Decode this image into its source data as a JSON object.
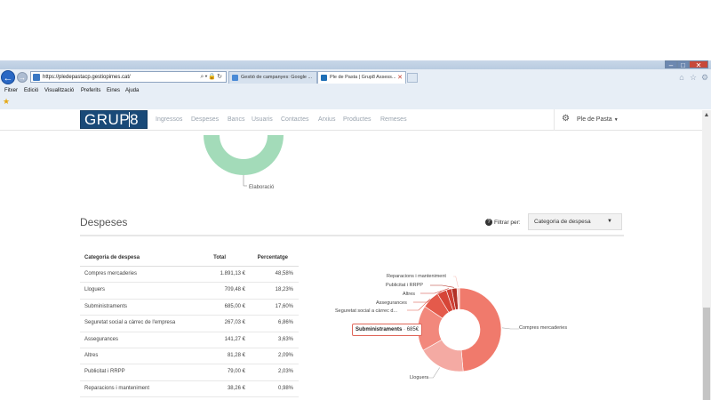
{
  "browser": {
    "address": "https://pledepastacp.gestiopimes.cat/",
    "tabs": [
      {
        "label": "Gestió de campanyes: Google ..."
      },
      {
        "label": "Ple de Pasta | Grup8 Assess..."
      }
    ],
    "menu": [
      "Fitxer",
      "Edició",
      "Visualització",
      "Preferits",
      "Eines",
      "Ajuda"
    ]
  },
  "site": {
    "logo": "GRUP8",
    "nav": [
      "Ingressos",
      "Despeses",
      "Bancs",
      "Usuaris",
      "Contactes",
      "Arxius",
      "Productes",
      "Remeses"
    ],
    "user": "Ple de Pasta"
  },
  "top_chart": {
    "label": "Elaboració",
    "color": "#a3dbb9"
  },
  "section": {
    "title": "Despeses",
    "filter_label": "Filtrar per:",
    "filter_value": "Categoria de despesa"
  },
  "table": {
    "headers": [
      "Categoria de despesa",
      "Total",
      "Percentatge"
    ],
    "rows": [
      [
        "Compres mercaderies",
        "1.891,13 €",
        "48,58%"
      ],
      [
        "Lloguers",
        "709,48 €",
        "18,23%"
      ],
      [
        "Subministraments",
        "685,00 €",
        "17,60%"
      ],
      [
        "Seguretat social a càrrec de l'empresa",
        "267,03 €",
        "6,86%"
      ],
      [
        "Assegurances",
        "141,27 €",
        "3,63%"
      ],
      [
        "Altres",
        "81,28 €",
        "2,09%"
      ],
      [
        "Publicitat i RRPP",
        "79,00 €",
        "2,03%"
      ],
      [
        "Reparacions i manteniment",
        "38,26 €",
        "0,98%"
      ]
    ]
  },
  "chart_data": {
    "type": "pie",
    "categories": [
      "Compres mercaderies",
      "Lloguers",
      "Subministraments",
      "Seguretat social a càrrec d...",
      "Assegurances",
      "Altres",
      "Publicitat i RRPP",
      "Reparacions i manteniment"
    ],
    "values": [
      48.58,
      18.23,
      17.6,
      6.86,
      3.63,
      2.09,
      2.03,
      0.98
    ],
    "colors": [
      "#f07a6c",
      "#f4aaa3",
      "#f2887c",
      "#e45a4b",
      "#d64537",
      "#cf3f33",
      "#b23126",
      "#f7c4be"
    ],
    "tooltip": {
      "label": "Subministraments",
      "value": "685€"
    }
  }
}
